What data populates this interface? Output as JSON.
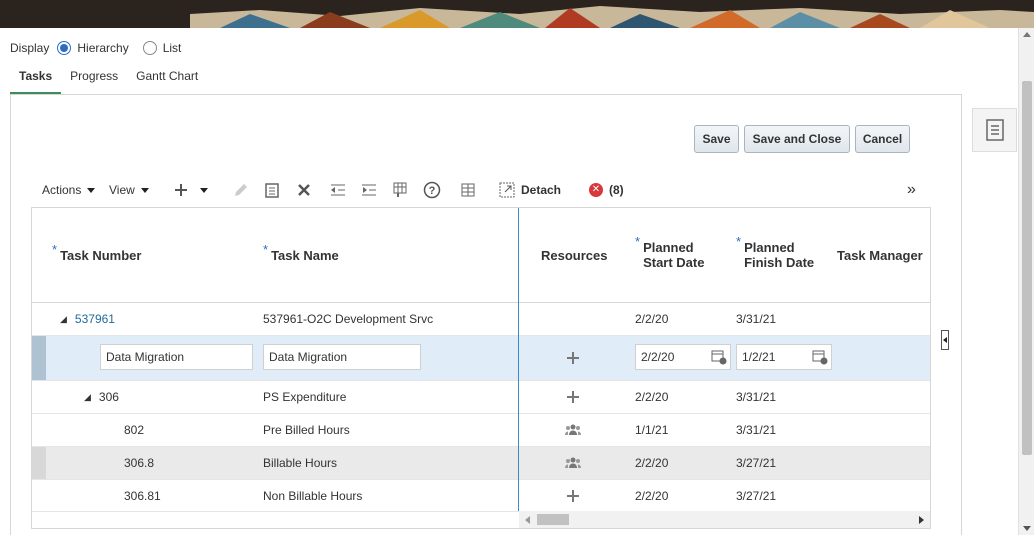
{
  "display": {
    "label": "Display",
    "options": [
      {
        "label": "Hierarchy",
        "selected": true
      },
      {
        "label": "List",
        "selected": false
      }
    ]
  },
  "tabs": [
    {
      "label": "Tasks",
      "active": true
    },
    {
      "label": "Progress",
      "active": false
    },
    {
      "label": "Gantt Chart",
      "active": false
    }
  ],
  "buttons": {
    "save": "Save",
    "save_close": "Save and Close",
    "cancel": "Cancel"
  },
  "toolbar": {
    "actions": "Actions",
    "view": "View",
    "detach": "Detach",
    "error_count": "(8)",
    "icons": [
      "add-icon",
      "edit-icon",
      "duplicate-icon",
      "delete-icon",
      "outdent-icon",
      "indent-icon",
      "manage-columns-icon",
      "help-icon",
      "freeze-icon",
      "detach-icon",
      "error-icon",
      "overflow-icon"
    ]
  },
  "grid": {
    "headers": {
      "task_number": "Task Number",
      "task_name": "Task Name",
      "resources": "Resources",
      "planned_start_1": "Planned",
      "planned_start_2": "Start Date",
      "planned_finish_1": "Planned",
      "planned_finish_2": "Finish Date",
      "task_manager": "Task Manager",
      "required_mark": "*"
    },
    "rows": [
      {
        "task_number": "537961",
        "task_name": "537961-O2C Development Srvc",
        "resources": "",
        "start": "2/2/20",
        "finish": "3/31/21"
      },
      {
        "task_number": "Data Migration",
        "task_name": "Data Migration",
        "resources": "add",
        "start": "2/2/20",
        "finish": "1/2/21",
        "editable": true
      },
      {
        "task_number": "306",
        "task_name": "PS Expenditure",
        "resources": "add",
        "start": "2/2/20",
        "finish": "3/31/21"
      },
      {
        "task_number": "802",
        "task_name": "Pre Billed Hours",
        "resources": "people",
        "start": "1/1/21",
        "finish": "3/31/21"
      },
      {
        "task_number": "306.8",
        "task_name": "Billable Hours",
        "resources": "people",
        "start": "2/2/20",
        "finish": "3/27/21"
      },
      {
        "task_number": "306.81",
        "task_name": "Non Billable Hours",
        "resources": "add",
        "start": "2/2/20",
        "finish": "3/27/21"
      }
    ]
  },
  "colors": {
    "accent_blue": "#2c6ebf",
    "tab_underline": "#3c8d5a",
    "link": "#216b99",
    "error_red": "#d8373c"
  }
}
